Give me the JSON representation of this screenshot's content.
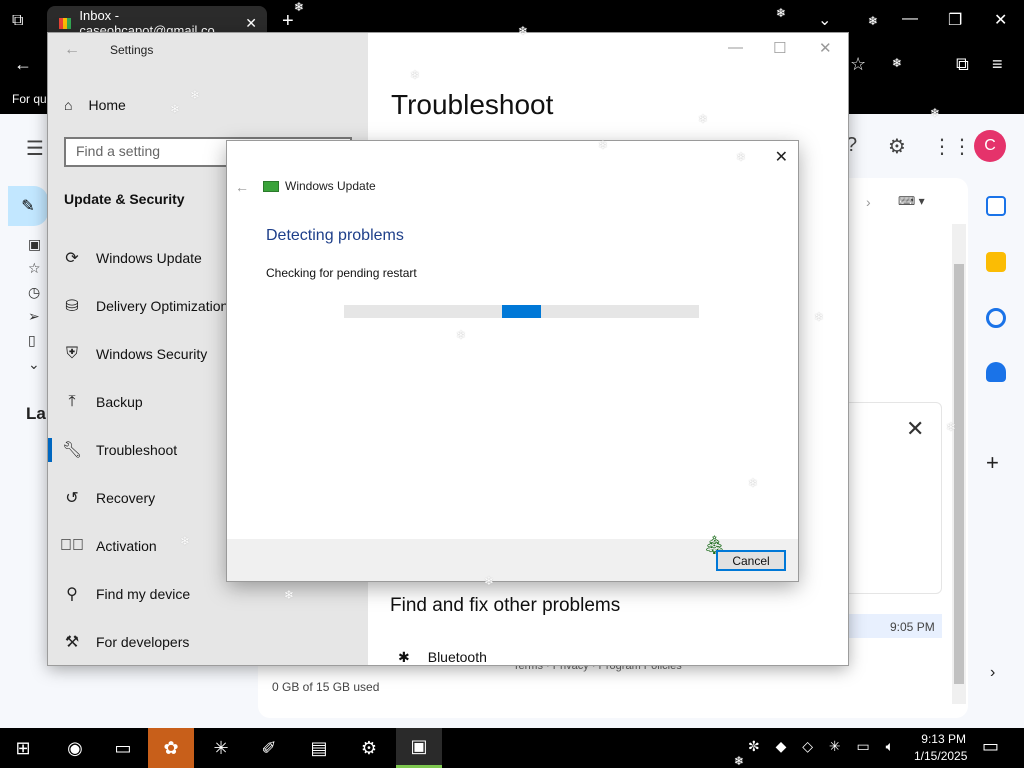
{
  "browser": {
    "tab_title": "Inbox - caseohcapot@gmail.co",
    "tab_close": "✕",
    "new_tab": "+",
    "bookmark_text": "For qui",
    "window_controls": {
      "dropdown": "⌄",
      "minimize": "—",
      "maximize": "❐",
      "close": "✕"
    }
  },
  "gmail": {
    "labels_heading": "Lab",
    "avatar_initial": "C",
    "mail_time": "9:05 PM",
    "storage": "0 GB of 15 GB used",
    "footer_links": "Terms · Privacy · Program Policies"
  },
  "settings": {
    "window_title": "Settings",
    "home_label": "Home",
    "search_placeholder": "Find a setting",
    "section_title": "Update & Security",
    "nav_items": [
      {
        "label": "Windows Update",
        "icon": "refresh-icon"
      },
      {
        "label": "Delivery Optimization",
        "icon": "delivery-icon"
      },
      {
        "label": "Windows Security",
        "icon": "shield-icon"
      },
      {
        "label": "Backup",
        "icon": "backup-arrow-icon"
      },
      {
        "label": "Troubleshoot",
        "icon": "wrench-icon"
      },
      {
        "label": "Recovery",
        "icon": "recovery-icon"
      },
      {
        "label": "Activation",
        "icon": "checkmark-circle-icon"
      },
      {
        "label": "Find my device",
        "icon": "person-pin-icon"
      },
      {
        "label": "For developers",
        "icon": "developer-tools-icon"
      }
    ],
    "active_item": "Troubleshoot",
    "page_heading": "Troubleshoot",
    "sub_heading": "Find and fix other problems",
    "bluetooth_label": "Bluetooth"
  },
  "dialog": {
    "title": "Windows Update",
    "heading": "Detecting problems",
    "status": "Checking for pending restart",
    "progress_position": 0.5,
    "cancel_label": "Cancel"
  },
  "taskbar": {
    "time": "9:13 PM",
    "date": "1/15/2025"
  }
}
